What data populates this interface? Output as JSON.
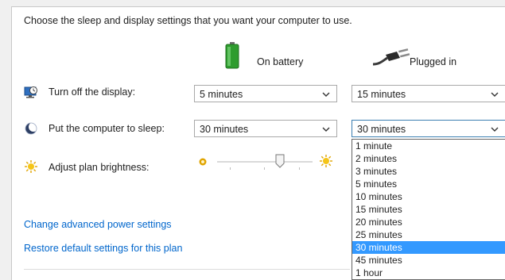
{
  "intro": "Choose the sleep and display settings that you want your computer to use.",
  "columns": {
    "battery": "On battery",
    "plugged": "Plugged in"
  },
  "rows": {
    "display": {
      "label": "Turn off the display:",
      "battery_value": "5 minutes",
      "plugged_value": "15 minutes"
    },
    "sleep": {
      "label": "Put the computer to sleep:",
      "battery_value": "30 minutes",
      "plugged_value": "30 minutes"
    },
    "brightness": {
      "label": "Adjust plan brightness:"
    }
  },
  "dropdown_options": [
    "1 minute",
    "2 minutes",
    "3 minutes",
    "5 minutes",
    "10 minutes",
    "15 minutes",
    "20 minutes",
    "25 minutes",
    "30 minutes",
    "45 minutes",
    "1 hour"
  ],
  "dropdown_selected": "30 minutes",
  "links": {
    "advanced": "Change advanced power settings",
    "restore": "Restore default settings for this plan"
  },
  "brightness_level": 0.68,
  "icons": {
    "display": "display-timer-icon",
    "sleep": "moon-sleep-icon",
    "brightness": "sun-icon",
    "battery": "battery-icon",
    "plugged": "power-plug-icon"
  },
  "colors": {
    "link": "#0066cc",
    "selection": "#3399ff",
    "battery_green": "#2e9c2e"
  }
}
